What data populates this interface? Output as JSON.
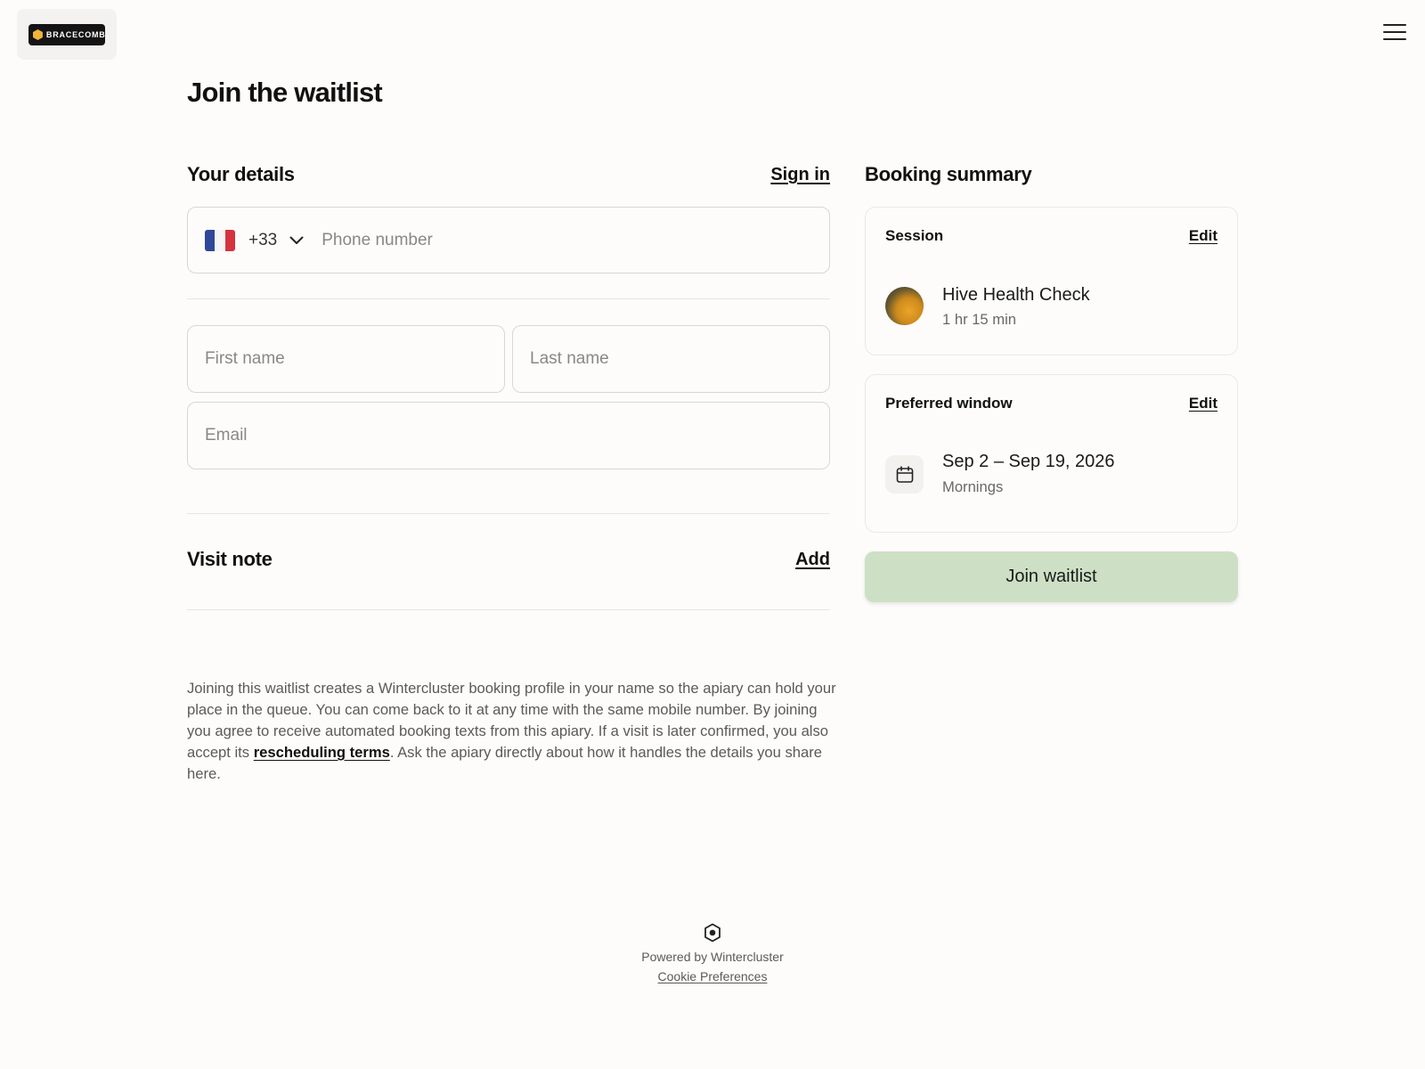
{
  "brand": {
    "logo_text": "BRACECOMB",
    "logo_icon": "hexagon-icon",
    "accent": "#f2b33d"
  },
  "header": {
    "menu_icon": "hamburger-menu-icon"
  },
  "page": {
    "title": "Join the waitlist"
  },
  "details": {
    "title": "Your details",
    "sign_in_label": "Sign in",
    "phone": {
      "country_flag": "france-flag-icon",
      "dial_code": "+33",
      "dropdown_icon": "chevron-down-icon",
      "value": "",
      "placeholder": "Phone number"
    },
    "first_name": {
      "value": "",
      "placeholder": "First name"
    },
    "last_name": {
      "value": "",
      "placeholder": "Last name"
    },
    "email": {
      "value": "",
      "placeholder": "Email"
    }
  },
  "visit_note": {
    "title": "Visit note",
    "add_label": "Add"
  },
  "legal": {
    "text_before": "Joining this waitlist creates a Wintercluster booking profile in your name so the apiary can hold your place in the queue. You can come back to it at any time with the same mobile number. By joining you agree to receive automated booking texts from this apiary. If a visit is later confirmed, you also accept its ",
    "link_label": "rescheduling terms",
    "text_after": ". Ask the apiary directly about how it handles the details you share here."
  },
  "summary": {
    "title": "Booking summary",
    "session": {
      "title": "Session",
      "edit_label": "Edit",
      "name": "Hive Health Check",
      "duration": "1 hr 15 min"
    },
    "window": {
      "title": "Preferred window",
      "edit_label": "Edit",
      "icon": "calendar-icon",
      "dates": "Sep 2 – Sep 19, 2026",
      "time_of_day": "Mornings"
    },
    "join_button_label": "Join waitlist",
    "join_button_color": "#cde0c5"
  },
  "footer": {
    "icon": "hexagon-logo-icon",
    "powered_by": "Powered by Wintercluster",
    "cookie_label": "Cookie Preferences"
  }
}
